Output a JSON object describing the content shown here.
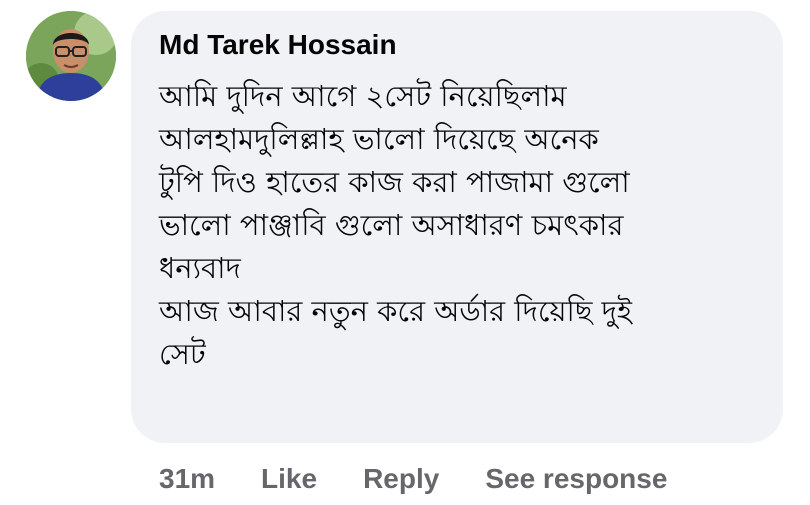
{
  "comment": {
    "author": "Md Tarek Hossain",
    "avatar_icon": "user-profile-photo",
    "lines": [
      "আমি দুদিন আগে ২সেট নিয়েছিলাম",
      "আলহামদুলিল্লাহ ভালো দিয়েছে অনেক",
      "টুপি দিও হাতের কাজ করা পাজামা গুলো",
      "ভালো পাঞ্জাবি গুলো অসাধারণ চমৎকার",
      "ধন্যবাদ",
      "আজ আবার নতুন করে অর্ডার দিয়েছি দুই",
      "সেট"
    ],
    "bubble_color": "#f0f2f5"
  },
  "actions": {
    "time": "31m",
    "like": "Like",
    "reply": "Reply",
    "see_response": "See response"
  }
}
